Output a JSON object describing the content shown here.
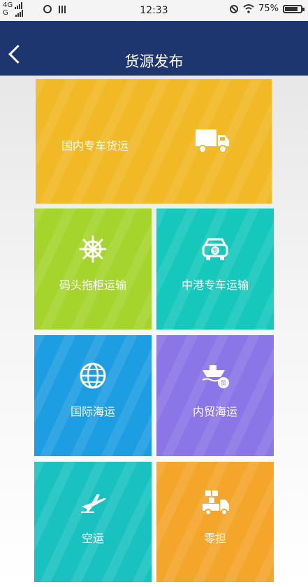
{
  "status_bar": {
    "network_top": "4G",
    "network_bottom": "G",
    "time": "12:33",
    "battery": "75%"
  },
  "navbar": {
    "title": "货源发布"
  },
  "tiles": [
    {
      "label": "国内专车货运",
      "icon": "truck-icon",
      "color": "#f1b925"
    },
    {
      "label": "码头拖柜运输",
      "icon": "ship-wheel-icon",
      "color": "#a5d42c"
    },
    {
      "label": "中港专车运输",
      "icon": "car-icon",
      "color": "#16c7bb"
    },
    {
      "label": "国际海运",
      "icon": "globe-icon",
      "color": "#1e9ee2"
    },
    {
      "label": "内贸海运",
      "icon": "cargo-ship-icon",
      "color": "#8a76e7"
    },
    {
      "label": "空运",
      "icon": "airplane-icon",
      "color": "#19c2c0"
    },
    {
      "label": "零担",
      "icon": "delivery-truck-icon",
      "color": "#f4a62a"
    }
  ]
}
